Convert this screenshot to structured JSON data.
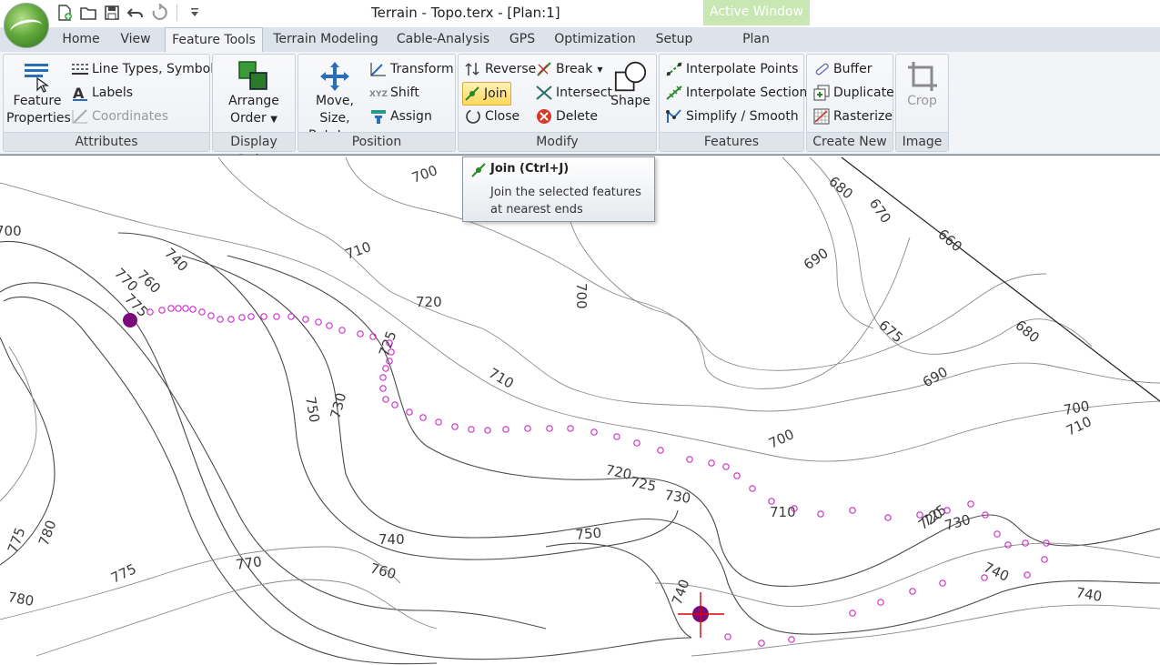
{
  "window": {
    "title": "Terrain - Topo.terx - [Plan:1]",
    "contextual_tab_group": "Active Window"
  },
  "quick_access": {
    "icons": [
      "new-document-icon",
      "open-folder-icon",
      "save-icon",
      "undo-icon",
      "redo-icon",
      "customize-dropdown-icon"
    ]
  },
  "tabs": [
    "Home",
    "View",
    "Feature Tools",
    "Terrain Modeling",
    "Cable-Analysis",
    "GPS",
    "Optimization",
    "Setup",
    "Plan"
  ],
  "active_tab": "Feature Tools",
  "ribbon": {
    "attributes": {
      "label": "Attributes",
      "feature_properties": "Feature Properties",
      "feature_properties_l1": "Feature",
      "feature_properties_l2": "Properties",
      "line_types": "Line Types, Symbols",
      "labels": "Labels",
      "coordinates": "Coordinates"
    },
    "display_order": {
      "label": "Display Order",
      "arrange_l1": "Arrange",
      "arrange_l2": "Order"
    },
    "position": {
      "label": "Position",
      "move_l1": "Move, Size,",
      "move_l2": "Rotate",
      "transform": "Transform",
      "shift": "Shift",
      "assign": "Assign"
    },
    "modify": {
      "label": "Modify",
      "reverse": "Reverse",
      "break": "Break",
      "join": "Join",
      "intersect": "Intersect",
      "close": "Close",
      "delete": "Delete",
      "shape": "Shape"
    },
    "features": {
      "label": "Features",
      "interpolate_points": "Interpolate Points",
      "interpolate_sections": "Interpolate Sections",
      "simplify": "Simplify / Smooth"
    },
    "create_new": {
      "label": "Create New",
      "buffer": "Buffer",
      "duplicate": "Duplicate",
      "rasterize": "Rasterize"
    },
    "image": {
      "label": "Image",
      "crop": "Crop"
    }
  },
  "tooltip": {
    "title": "Join (Ctrl+J)",
    "description": "Join the selected features at nearest ends"
  },
  "map": {
    "contour_labels": [
      "700",
      "710",
      "720",
      "725",
      "730",
      "740",
      "750",
      "760",
      "770",
      "775",
      "780",
      "675",
      "680",
      "690",
      "660",
      "670"
    ],
    "colors": {
      "contour": "#4a4a4a",
      "contour_light": "#8a8a8a",
      "selected_points": "#cc33cc",
      "endpoint": "#7a0a7a",
      "cursor": "#dd0000"
    }
  }
}
